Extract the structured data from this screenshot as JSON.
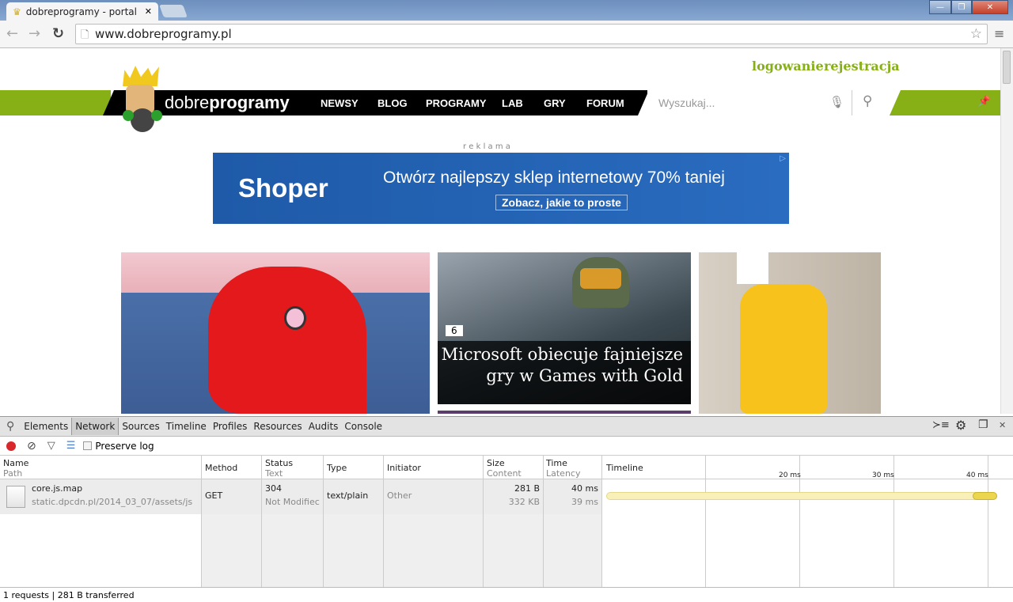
{
  "browser": {
    "tab_title": "dobreprogramy - portal ni",
    "url": "www.dobreprogramy.pl"
  },
  "site": {
    "login": "logowanie",
    "register": "rejestracja",
    "logo_light": "dobre",
    "logo_bold": "programy",
    "nav": [
      "NEWSY",
      "BLOG",
      "PROGRAMY",
      "LAB",
      "GRY",
      "FORUM"
    ],
    "search_placeholder": "Wyszukaj...",
    "ad_label": "r e k l a m a",
    "ad": {
      "brand": "Shoper",
      "headline": "Otwórz najlepszy sklep internetowy 70% taniej",
      "cta": "Zobacz, jakie to proste"
    },
    "featured": {
      "comments": "6",
      "title_line1": "Microsoft obiecuje fajniejsze",
      "title_line2": "gry w Games with Gold"
    }
  },
  "devtools": {
    "tabs": [
      "Elements",
      "Network",
      "Sources",
      "Timeline",
      "Profiles",
      "Resources",
      "Audits",
      "Console"
    ],
    "active_tab": "Network",
    "preserve_log": "Preserve log",
    "headers": {
      "name": "Name",
      "path": "Path",
      "method": "Method",
      "status": "Status",
      "text": "Text",
      "type": "Type",
      "initiator": "Initiator",
      "size": "Size",
      "content": "Content",
      "time": "Time",
      "latency": "Latency",
      "timeline": "Timeline"
    },
    "ticks": [
      "20 ms",
      "30 ms",
      "40 ms"
    ],
    "rows": [
      {
        "name": "core.js.map",
        "path": "static.dpcdn.pl/2014_03_07/assets/js",
        "method": "GET",
        "status": "304",
        "status_text": "Not Modifiec",
        "type": "text/plain",
        "initiator": "Other",
        "size": "281 B",
        "content": "332 KB",
        "time": "40 ms",
        "latency": "39 ms"
      }
    ],
    "summary": "1 requests | 281 B transferred"
  }
}
